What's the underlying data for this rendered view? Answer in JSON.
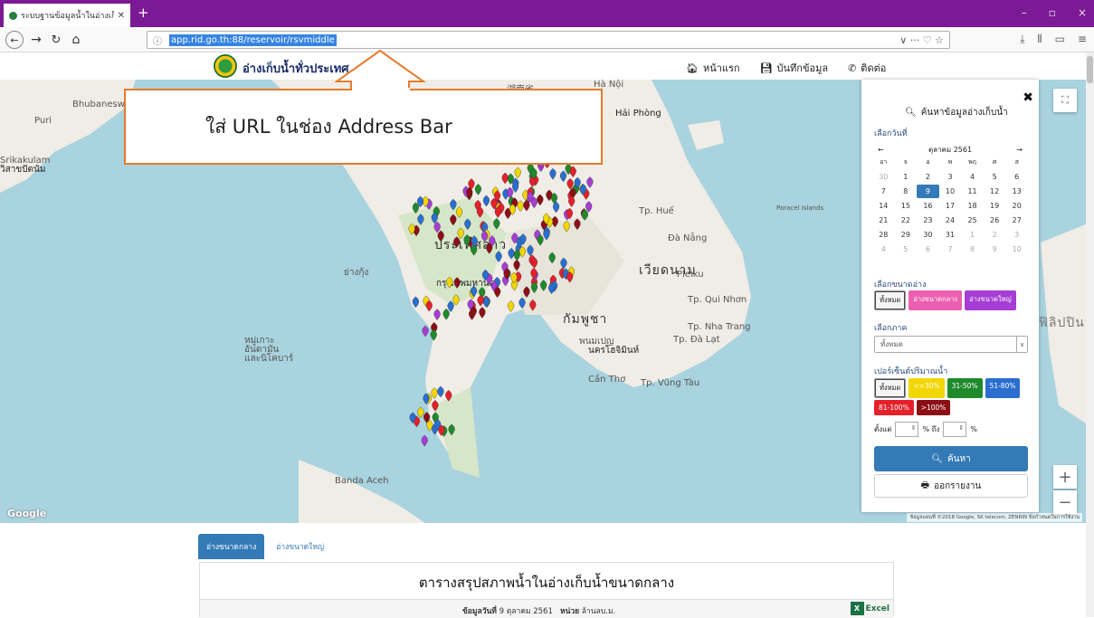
{
  "browser": {
    "tab_title": "ระบบฐานข้อมูลน้ำในอ่างเก็บน้ำ ภ",
    "url": "app.rid.go.th:88/reservoir/rsvmiddle",
    "url_actions": "∨  ···  ♡  ☆",
    "window_controls": [
      "–",
      "▫",
      "×"
    ]
  },
  "site": {
    "title": "อ่างเก็บน้ำทั่วประเทศ",
    "menu": [
      {
        "icon": "home-icon",
        "label": "หน้าแรก"
      },
      {
        "icon": "save-icon",
        "label": "บันทึกข้อมูล"
      },
      {
        "icon": "phone-icon",
        "label": "ติดต่อ"
      }
    ]
  },
  "callout": {
    "text": "ใส่ URL ในช่อง Address Bar",
    "color": "#e57b2c"
  },
  "map": {
    "google": "Google",
    "attribution": "ข้อมูลแผนที่ ©2018 Google, SK telecom, ZENRIN   ข้อกำหนดในการใช้งาน",
    "labels": {
      "vientiane": "ประเทศลาว",
      "bangkok": "กรุงเทพมหานคร",
      "cambodia": "กัมพูชา",
      "vietnam": "เวียดนาม",
      "philippines": "ฟิลิปปินส์",
      "hcm": "นครโฮจิมินห์",
      "visakhapatnam": "วิสาขปัตนัม",
      "hanoi": "Hà Nội",
      "paracel": "Paracel Islands",
      "phnompenh": "พนมเปญ",
      "banda": "Banda Aceh",
      "hue": "Tp. Huế",
      "danang": "Đà Nẵng",
      "pleiku": "Pleiku",
      "quinhon": "Tp. Qui Nhơn",
      "nhatrang": "Tp. Nha Trang",
      "cantho": "Cần Thơ",
      "vungtau": "Tp. Vũng Tàu",
      "srikakulam": "Srikakulam",
      "puri": "Puri",
      "bhubaneswar": "Bhubaneswar",
      "haiphong": "Hải Phòng",
      "dalat": "Tp. Đà Lạt",
      "andaman": "หมู่เกาะ\nอันดามัน\nและนิโคบาร์",
      "chinese": "湖南省",
      "myanmar": "ย่างกุ้ง"
    }
  },
  "panel": {
    "title": "ค้นหาข้อมูลอ่างเก็บน้ำ",
    "date_label": "เลือกวันที่",
    "month": "ตุลาคม 2561",
    "prev": "←",
    "next": "→",
    "dow": [
      "อา",
      "จ",
      "อ",
      "พ",
      "พฤ",
      "ศ",
      "ส"
    ],
    "weeks": [
      [
        {
          "d": "30",
          "m": "dim"
        },
        {
          "d": "1"
        },
        {
          "d": "2"
        },
        {
          "d": "3"
        },
        {
          "d": "4"
        },
        {
          "d": "5"
        },
        {
          "d": "6"
        }
      ],
      [
        {
          "d": "7"
        },
        {
          "d": "8"
        },
        {
          "d": "9",
          "m": "sel"
        },
        {
          "d": "10"
        },
        {
          "d": "11"
        },
        {
          "d": "12"
        },
        {
          "d": "13"
        }
      ],
      [
        {
          "d": "14"
        },
        {
          "d": "15"
        },
        {
          "d": "16"
        },
        {
          "d": "17"
        },
        {
          "d": "18"
        },
        {
          "d": "19"
        },
        {
          "d": "20"
        }
      ],
      [
        {
          "d": "21"
        },
        {
          "d": "22"
        },
        {
          "d": "23"
        },
        {
          "d": "24"
        },
        {
          "d": "25"
        },
        {
          "d": "26"
        },
        {
          "d": "27"
        }
      ],
      [
        {
          "d": "28"
        },
        {
          "d": "29"
        },
        {
          "d": "30"
        },
        {
          "d": "31"
        },
        {
          "d": "1",
          "m": "dim"
        },
        {
          "d": "2",
          "m": "dim"
        },
        {
          "d": "3",
          "m": "dim"
        }
      ],
      [
        {
          "d": "4",
          "m": "dim"
        },
        {
          "d": "5",
          "m": "dim"
        },
        {
          "d": "6",
          "m": "dim"
        },
        {
          "d": "7",
          "m": "dim"
        },
        {
          "d": "8",
          "m": "dim"
        },
        {
          "d": "9",
          "m": "dim"
        },
        {
          "d": "10",
          "m": "dim"
        }
      ]
    ],
    "size_label": "เลือกขนาดอ่าง",
    "size_buttons": [
      {
        "label": "ทั้งหมด",
        "style": "outline",
        "color": "#f5f5f5"
      },
      {
        "label": "อ่างขนาดกลาง",
        "style": "fill",
        "color": "#ec5fb0"
      },
      {
        "label": "อ่างขนาดใหญ่",
        "style": "fill",
        "color": "#a63dd4"
      }
    ],
    "region_label": "เลือกภาค",
    "region_value": "ทั้งหมด",
    "percent_label": "เปอร์เซ็นต์ปริมาณน้ำ",
    "percent_row1": [
      {
        "label": "ทั้งหมด",
        "style": "outline",
        "color": "#f5f5f5"
      },
      {
        "label": "<=30%",
        "style": "fill",
        "color": "#f2d600"
      },
      {
        "label": "31-50%",
        "style": "fill",
        "color": "#1f8a2c"
      },
      {
        "label": "51-80%",
        "style": "fill",
        "color": "#2a6fd0"
      }
    ],
    "percent_row2": [
      {
        "label": "81-100%",
        "style": "fill",
        "color": "#e5202a"
      },
      {
        "label": ">100%",
        "style": "fill",
        "color": "#8c0f16"
      }
    ],
    "range_from": "ตั้งแต่",
    "range_pct": "% ถึง",
    "range_pct2": "%",
    "search_btn": "ค้นหา",
    "report_btn": "ออกรายงาน"
  },
  "bottom": {
    "tab_active": "อ่างขนาดกลาง",
    "tab_inactive": "อ่างขนาดใหญ่",
    "table_title": "ตารางสรุปสภาพน้ำในอ่างเก็บน้ำขนาดกลาง",
    "info_prefix": "ข้อมูลวันที่",
    "info_date": "9 ตุลาคม 2561",
    "info_unit_label": "หน่วย",
    "info_unit": "ล้านลบ.ม.",
    "excel": "Excel"
  }
}
